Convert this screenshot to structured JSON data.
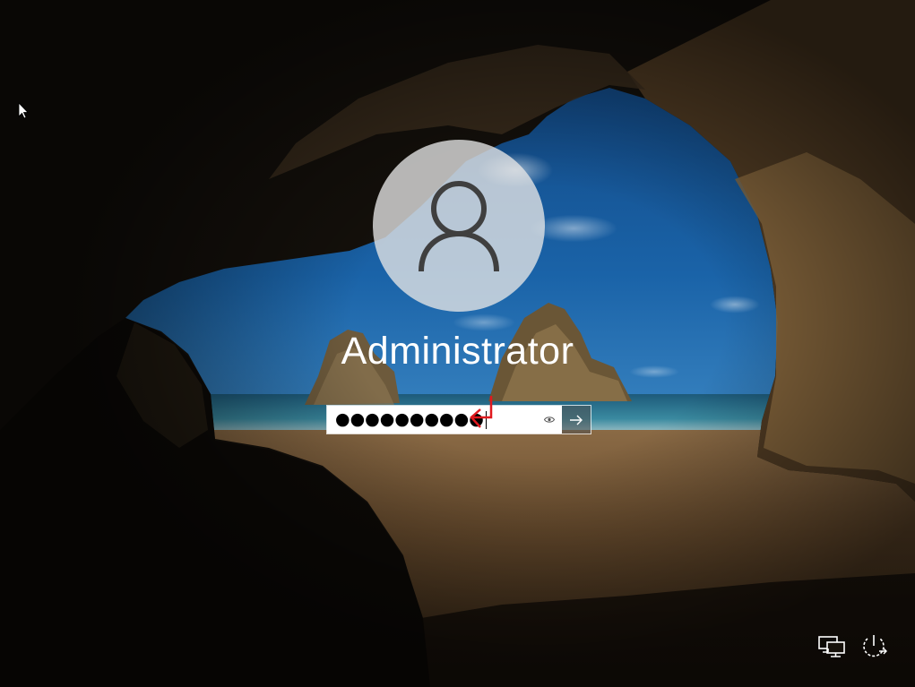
{
  "user": {
    "name": "Administrator",
    "avatar_icon": "user-silhouette-icon"
  },
  "password": {
    "masked_value": "●●●●●●●●●●",
    "reveal_icon": "eye-icon",
    "submit_icon": "arrow-right-icon"
  },
  "annotation": {
    "icon": "enter-arrow-icon",
    "color": "#e0191e"
  },
  "tray": {
    "network_icon": "network-icon",
    "power_icon": "power-icon"
  }
}
